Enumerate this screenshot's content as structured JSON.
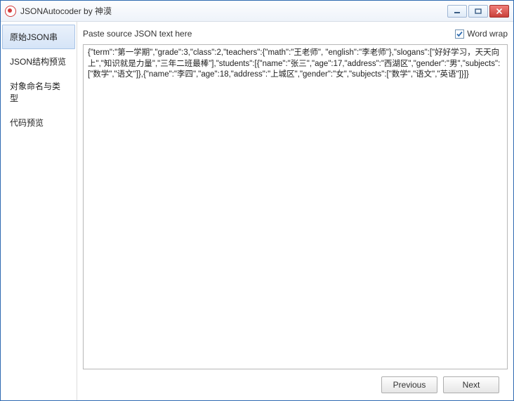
{
  "window": {
    "title": "JSONAutocoder by 神漠"
  },
  "sidebar": {
    "items": [
      {
        "label": "原始JSON串",
        "selected": true
      },
      {
        "label": "JSON结构预览",
        "selected": false
      },
      {
        "label": "对象命名与类型",
        "selected": false
      },
      {
        "label": "代码预览",
        "selected": false
      }
    ]
  },
  "main": {
    "paste_label": "Paste source JSON text here",
    "wordwrap_label": "Word wrap",
    "wordwrap_checked": true,
    "json_text": "{\"term\":\"第一学期\",\"grade\":3,\"class\":2,\"teachers\":{\"math\":\"王老师\", \"english\":\"李老师\"},\"slogans\":[\"好好学习，天天向上\",\"知识就是力量\",\"三年二班最棒\"],\"students\":[{\"name\":\"张三\",\"age\":17,\"address\":\"西湖区\",\"gender\":\"男\",\"subjects\":[\"数学\",\"语文\"]},{\"name\":\"李四\",\"age\":18,\"address\":\"上城区\",\"gender\":\"女\",\"subjects\":[\"数学\",\"语文\",\"英语\"]}]}"
  },
  "footer": {
    "previous_label": "Previous",
    "next_label": "Next"
  }
}
